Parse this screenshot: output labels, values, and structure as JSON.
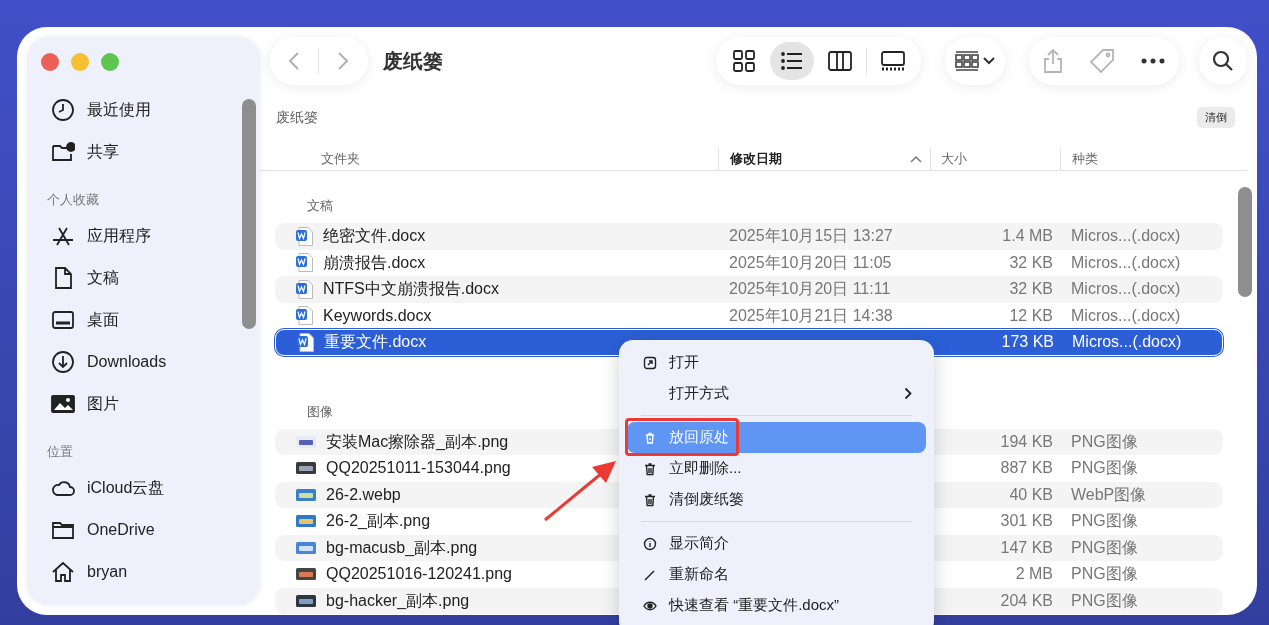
{
  "window": {
    "title": "废纸篓"
  },
  "sidebar": {
    "sections": [
      {
        "items": [
          {
            "label": "最近使用",
            "kind": "recents"
          },
          {
            "label": "共享",
            "kind": "shared"
          }
        ]
      },
      {
        "title": "个人收藏",
        "items": [
          {
            "label": "应用程序",
            "kind": "apps"
          },
          {
            "label": "文稿",
            "kind": "documents"
          },
          {
            "label": "桌面",
            "kind": "desktop"
          },
          {
            "label": "Downloads",
            "kind": "downloads"
          },
          {
            "label": "图片",
            "kind": "pictures"
          }
        ]
      },
      {
        "title": "位置",
        "items": [
          {
            "label": "iCloud云盘",
            "kind": "cloud"
          },
          {
            "label": "OneDrive",
            "kind": "folder"
          },
          {
            "label": "bryan",
            "kind": "home"
          }
        ]
      }
    ]
  },
  "toolbar": {
    "views": [
      {
        "kind": "icons",
        "selected": false
      },
      {
        "kind": "list",
        "selected": true
      },
      {
        "kind": "columns",
        "selected": false
      },
      {
        "kind": "gallery",
        "selected": false
      }
    ]
  },
  "location": {
    "title": "废纸篓",
    "action": "清倒"
  },
  "columns": [
    {
      "label": "文件夹",
      "sorted": false
    },
    {
      "label": "修改日期",
      "sorted": true
    },
    {
      "label": "大小",
      "sorted": false
    },
    {
      "label": "种类",
      "sorted": false
    }
  ],
  "groups": [
    {
      "title": "文稿",
      "rows": [
        {
          "kind": "word",
          "name": "绝密文件.docx",
          "date": "2025年10月15日 13:27",
          "size": "1.4 MB",
          "type": "Micros...(.docx)",
          "selected": false
        },
        {
          "kind": "word",
          "name": "崩溃报告.docx",
          "date": "2025年10月20日 11:05",
          "size": "32 KB",
          "type": "Micros...(.docx)",
          "selected": false
        },
        {
          "kind": "word",
          "name": "NTFS中文崩溃报告.docx",
          "date": "2025年10月20日 11:11",
          "size": "32 KB",
          "type": "Micros...(.docx)",
          "selected": false
        },
        {
          "kind": "word",
          "name": "Keywords.docx",
          "date": "2025年10月21日 14:38",
          "size": "12 KB",
          "type": "Micros...(.docx)",
          "selected": false
        },
        {
          "kind": "word",
          "name": "重要文件.docx",
          "size": "173 KB",
          "type": "Micros...(.docx)",
          "selected": true
        }
      ]
    },
    {
      "title": "图像",
      "rows": [
        {
          "kind": "image",
          "name": "安装Mac擦除器_副本.png",
          "size": "194 KB",
          "type": "PNG图像",
          "selected": false
        },
        {
          "kind": "image",
          "name": "QQ20251011-153044.png",
          "size": "887 KB",
          "type": "PNG图像",
          "selected": false
        },
        {
          "kind": "image",
          "name": "26-2.webp",
          "size": "40 KB",
          "type": "WebP图像",
          "selected": false
        },
        {
          "kind": "image",
          "name": "26-2_副本.png",
          "size": "301 KB",
          "type": "PNG图像",
          "selected": false
        },
        {
          "kind": "image",
          "name": "bg-macusb_副本.png",
          "size": "147 KB",
          "type": "PNG图像",
          "selected": false
        },
        {
          "kind": "image",
          "name": "QQ20251016-120241.png",
          "size": "2 MB",
          "type": "PNG图像",
          "selected": false
        },
        {
          "kind": "image",
          "name": "bg-hacker_副本.png",
          "size": "204 KB",
          "type": "PNG图像",
          "selected": false
        }
      ]
    }
  ],
  "context_menu": {
    "items": [
      {
        "kind": "open",
        "label": "打开",
        "highlighted": false,
        "annotated": false
      },
      {
        "kind": "submenu",
        "label": "打开方式",
        "highlighted": false,
        "annotated": false
      },
      {
        "kind": "separator"
      },
      {
        "kind": "restore",
        "label": "放回原处",
        "highlighted": true,
        "annotated": true
      },
      {
        "kind": "delete",
        "label": "立即删除...",
        "highlighted": false,
        "annotated": false
      },
      {
        "kind": "delete",
        "label": "清倒废纸篓",
        "highlighted": false,
        "annotated": false
      },
      {
        "kind": "separator"
      },
      {
        "kind": "info",
        "label": "显示简介",
        "highlighted": false,
        "annotated": false
      },
      {
        "kind": "rename",
        "label": "重新命名",
        "highlighted": false,
        "annotated": false
      },
      {
        "kind": "quicklook",
        "label": "快速查看 “重要文件.docx”",
        "highlighted": false,
        "annotated": false
      }
    ]
  }
}
